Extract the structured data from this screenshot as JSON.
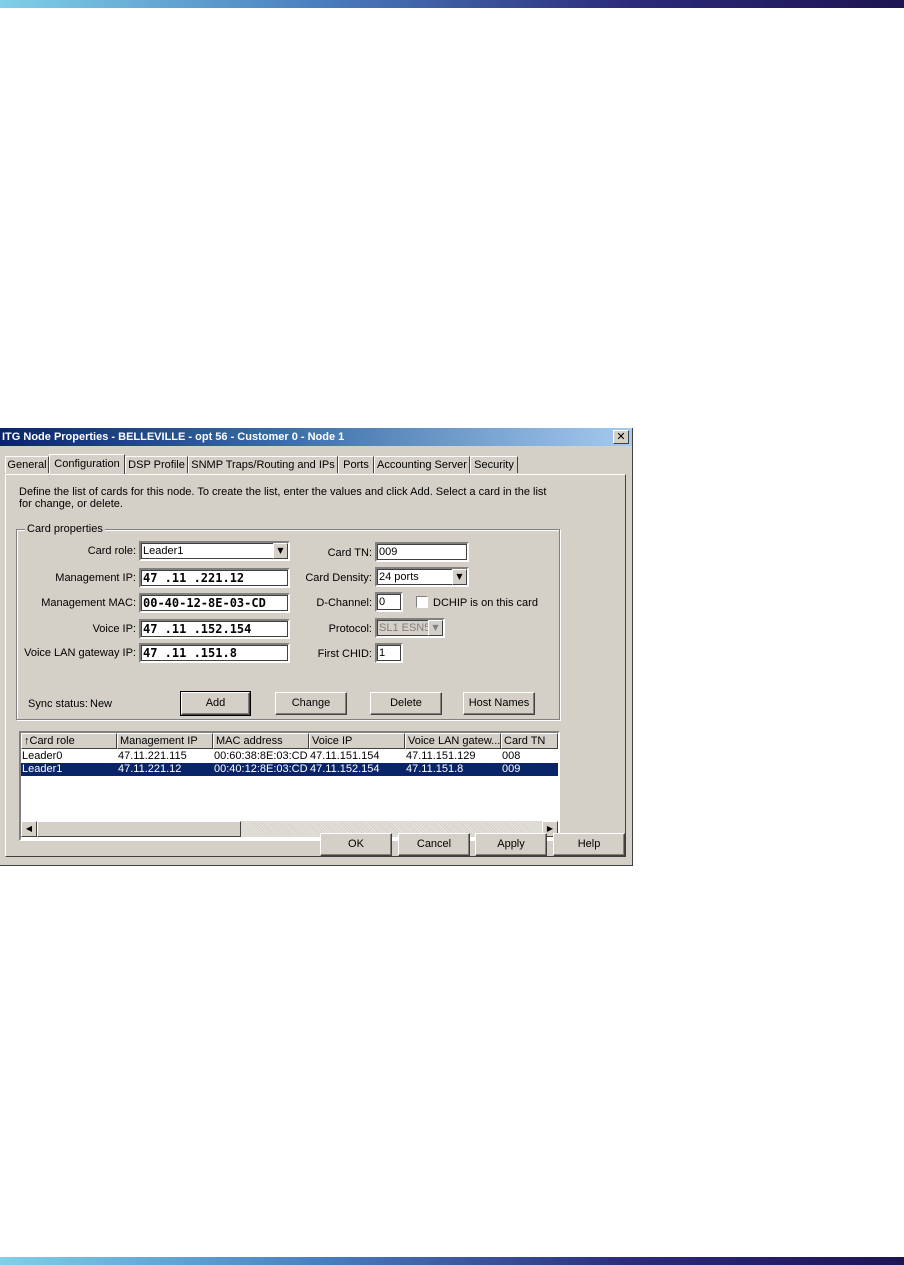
{
  "window": {
    "title": "ITG Node Properties - BELLEVILLE - opt 56 - Customer 0 - Node 1",
    "close_glyph": "✕"
  },
  "tabs": [
    "General",
    "Configuration",
    "DSP Profile",
    "SNMP Traps/Routing and IPs",
    "Ports",
    "Accounting Server",
    "Security"
  ],
  "active_tab": "Configuration",
  "instructions": "Define the list of cards for this node.  To create the list, enter the values and click Add.  Select a card in the list for change, or delete.",
  "card_properties": {
    "legend": "Card properties",
    "card_role_label": "Card role:",
    "card_role_value": "Leader1",
    "management_ip_label": "Management IP:",
    "management_ip_value": "47 .11 .221.12",
    "management_mac_label": "Management MAC:",
    "management_mac_value": "00-40-12-8E-03-CD",
    "voice_ip_label": "Voice IP:",
    "voice_ip_value": "47 .11 .152.154",
    "voice_gateway_label": "Voice LAN gateway IP:",
    "voice_gateway_value": "47 .11 .151.8",
    "card_tn_label": "Card TN:",
    "card_tn_value": "009",
    "card_density_label": "Card Density:",
    "card_density_value": "24 ports",
    "d_channel_label": "D-Channel:",
    "d_channel_value": "0",
    "dchip_label": "DCHIP is on this card",
    "dchip_checked": false,
    "protocol_label": "Protocol:",
    "protocol_value": "SL1 ESN5",
    "first_chid_label": "First CHID:",
    "first_chid_value": "1",
    "sync_status_label": "Sync status:",
    "sync_status_value": "New"
  },
  "actions": {
    "add": "Add",
    "change": "Change",
    "delete": "Delete",
    "host_names": "Host Names"
  },
  "card_list": {
    "sort_indicator": "↑",
    "columns": [
      "Card role",
      "Management IP",
      "MAC address",
      "Voice IP",
      "Voice LAN gatew...",
      "Card TN"
    ],
    "rows": [
      [
        "Leader0",
        "47.11.221.115",
        "00:60:38:8E:03:CD",
        "47.11.151.154",
        "47.11.151.129",
        "008"
      ],
      [
        "Leader1",
        "47.11.221.12",
        "00:40:12:8E:03:CD",
        "47.11.152.154",
        "47.11.151.8",
        "009"
      ]
    ],
    "selected_row": 1
  },
  "footer": {
    "ok": "OK",
    "cancel": "Cancel",
    "apply": "Apply",
    "help": "Help"
  },
  "icons": {
    "dropdown": "dropdown-arrow-icon",
    "scroll_left": "scroll-left-icon",
    "scroll_right": "scroll-right-icon"
  },
  "colors": {
    "dialog_face": "#d4d0c8",
    "titlebar_start": "#0a246a",
    "selection": "#0a246a"
  }
}
